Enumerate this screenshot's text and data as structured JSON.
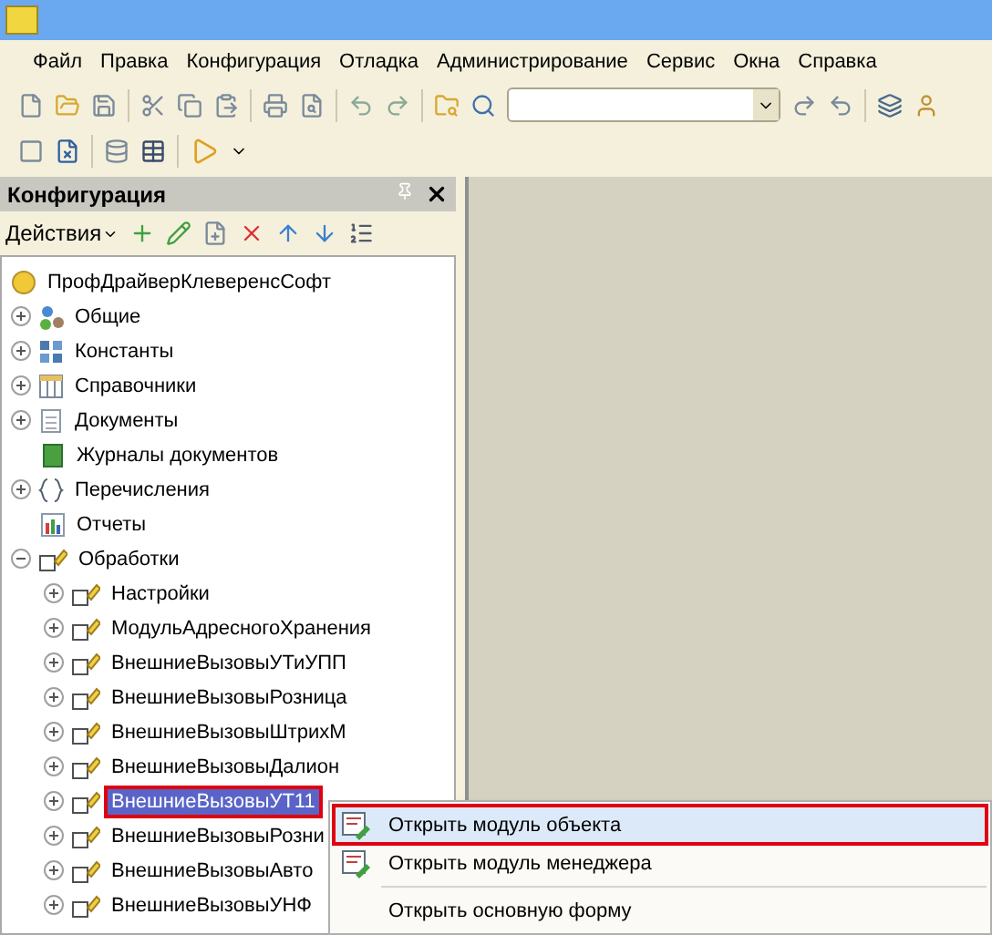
{
  "menu": [
    {
      "label": "Файл"
    },
    {
      "label": "Правка"
    },
    {
      "label": "Конфигурация"
    },
    {
      "label": "Отладка"
    },
    {
      "label": "Администрирование"
    },
    {
      "label": "Сервис"
    },
    {
      "label": "Окна"
    },
    {
      "label": "Справка"
    }
  ],
  "panel": {
    "title": "Конфигурация",
    "actions": "Действия"
  },
  "tree": {
    "label": "ПрофДрайверКлеверенсСофт",
    "kind": "root",
    "children": [
      {
        "label": "Общие",
        "kind": "common",
        "expanded": false,
        "selected": false
      },
      {
        "label": "Константы",
        "kind": "constants",
        "expanded": false,
        "selected": false
      },
      {
        "label": "Справочники",
        "kind": "catalogs",
        "expanded": false,
        "selected": false
      },
      {
        "label": "Документы",
        "kind": "documents",
        "expanded": false,
        "selected": false
      },
      {
        "label": "Журналы документов",
        "kind": "journals",
        "selected": false
      },
      {
        "label": "Перечисления",
        "kind": "enums",
        "expanded": false,
        "selected": false
      },
      {
        "label": "Отчеты",
        "kind": "reports",
        "selected": false
      },
      {
        "label": "Обработки",
        "kind": "processing",
        "expanded": true,
        "selected": false,
        "children": [
          {
            "label": "Настройки",
            "kind": "processing",
            "expanded": false,
            "selected": false
          },
          {
            "label": "МодульАдресногоХранения",
            "kind": "processing",
            "expanded": false,
            "selected": false
          },
          {
            "label": "ВнешниеВызовыУТиУПП",
            "kind": "processing",
            "expanded": false,
            "selected": false
          },
          {
            "label": "ВнешниеВызовыРозница",
            "kind": "processing",
            "expanded": false,
            "selected": false
          },
          {
            "label": "ВнешниеВызовыШтрихМ",
            "kind": "processing",
            "expanded": false,
            "selected": false
          },
          {
            "label": "ВнешниеВызовыДалион",
            "kind": "processing",
            "expanded": false,
            "selected": false
          },
          {
            "label": "ВнешниеВызовыУТ11",
            "kind": "processing",
            "expanded": false,
            "selected": true
          },
          {
            "label": "ВнешниеВызовыРозни",
            "kind": "processing",
            "expanded": false,
            "selected": false
          },
          {
            "label": "ВнешниеВызовыАвто",
            "kind": "processing",
            "expanded": false,
            "selected": false
          },
          {
            "label": "ВнешниеВызовыУНФ",
            "kind": "processing",
            "expanded": false,
            "selected": false
          }
        ]
      }
    ]
  },
  "context_menu": [
    {
      "kind": "item",
      "label": "Открыть модуль объекта",
      "selected": true
    },
    {
      "kind": "item",
      "label": "Открыть модуль менеджера",
      "selected": false
    },
    {
      "kind": "separator"
    },
    {
      "kind": "plain",
      "label": "Открыть основную форму",
      "selected": false
    }
  ]
}
